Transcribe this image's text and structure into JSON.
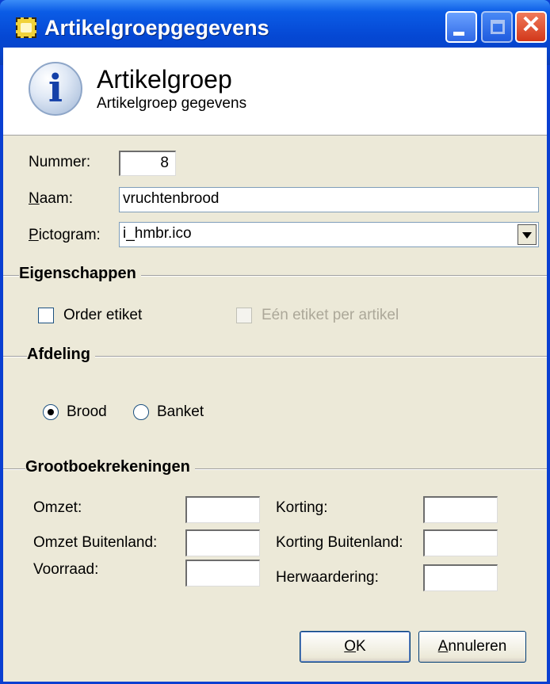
{
  "window": {
    "title": "Artikelgroepgegevens",
    "title_icon": "app-icon",
    "controls": {
      "minimize": "_",
      "maximize": "□",
      "close": "✕"
    }
  },
  "header": {
    "icon": "info-icon",
    "title": "Artikelgroep",
    "subtitle": "Artikelgroep gegevens"
  },
  "form": {
    "nummer_label": "Nummer:",
    "nummer_value": "8",
    "naam_label_first": "N",
    "naam_label_rest": "aam:",
    "naam_value": "vruchtenbrood",
    "pictogram_label_first": "P",
    "pictogram_label_rest": "ictogram:",
    "pictogram_value": "i_hmbr.ico"
  },
  "eigenschappen": {
    "title": "Eigenschappen",
    "order_etiket": {
      "label": "Order etiket",
      "checked": false
    },
    "een_etiket": {
      "label": "Eén etiket per artikel",
      "checked": false,
      "enabled": false
    }
  },
  "afdeling": {
    "title": "Afdeling",
    "options": [
      {
        "label": "Brood",
        "selected": true
      },
      {
        "label": "Banket",
        "selected": false
      }
    ]
  },
  "grootboek": {
    "title": "Grootboekrekeningen",
    "omzet_label": "Omzet:",
    "omzet_value": "",
    "omzet_buitenland_label": "Omzet Buitenland:",
    "omzet_buitenland_value": "",
    "voorraad_label": "Voorraad:",
    "voorraad_value": "",
    "korting_label": "Korting:",
    "korting_value": "",
    "korting_buitenland_label": "Korting Buitenland:",
    "korting_buitenland_value": "",
    "herwaardering_label": "Herwaardering:",
    "herwaardering_value": ""
  },
  "buttons": {
    "ok_first": "O",
    "ok_rest": "K",
    "annuleren_first": "A",
    "annuleren_rest": "nnuleren"
  },
  "colors": {
    "titlebar": "#0548d4",
    "client_background": "#ece9d8",
    "close_button": "#d2381a"
  }
}
